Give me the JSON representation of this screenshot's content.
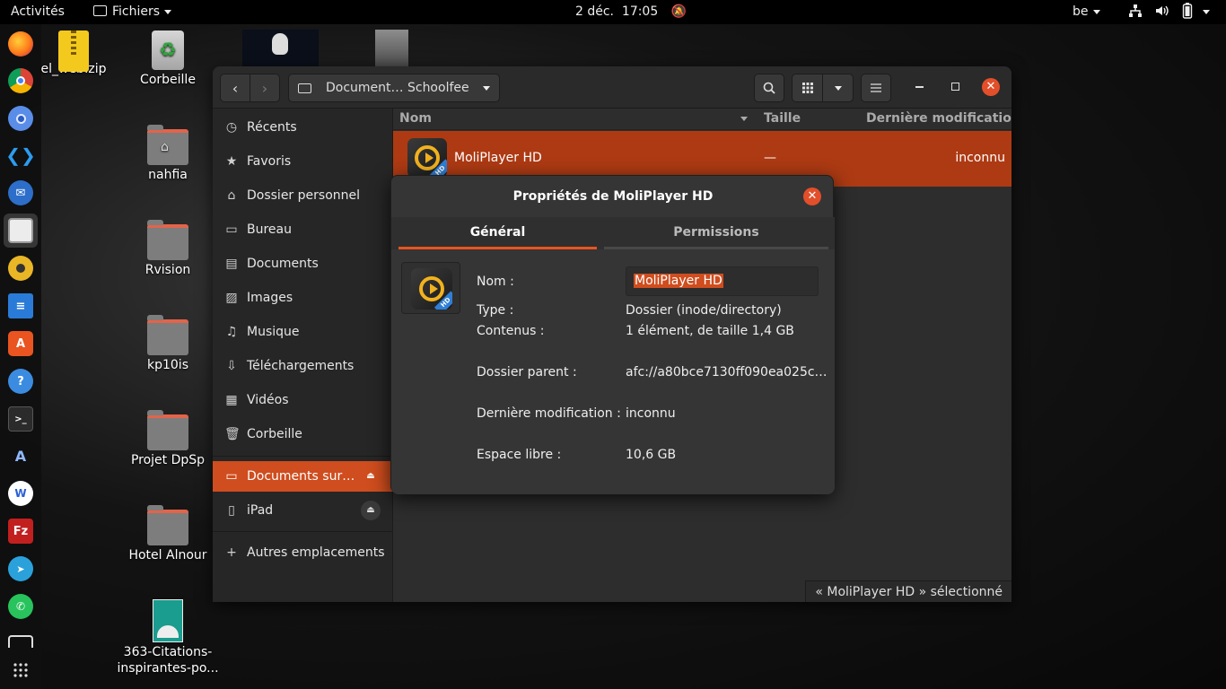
{
  "topbar": {
    "activities": "Activités",
    "app_menu": "Fichiers",
    "datetime": "2 déc.  17:05",
    "keyboard_layout": "be"
  },
  "dock": {
    "items": [
      "firefox",
      "chrome",
      "chromium",
      "vscode",
      "thunderbird",
      "files",
      "rhythmbox",
      "libreoffice-writer",
      "software-center",
      "help",
      "terminal",
      "dictionary",
      "wps",
      "filezilla",
      "telegram",
      "whatsapp",
      "trash",
      "show-apps"
    ]
  },
  "desktop": {
    "icons": [
      {
        "label": "el_web.zip"
      },
      {
        "label": "Corbeille"
      },
      {
        "label": "nahfia"
      },
      {
        "label": "Rvision"
      },
      {
        "label": "kp10is"
      },
      {
        "label": "Projet DpSp"
      },
      {
        "label": "Hotel Alnour"
      },
      {
        "label_line1": "363-Citations-",
        "label_line2": "inspirantes-po..."
      }
    ]
  },
  "fm": {
    "location": "Document… Schoolfee",
    "sidebar": [
      {
        "label": "Récents",
        "icon": "clock-icon"
      },
      {
        "label": "Favoris",
        "icon": "star-icon"
      },
      {
        "label": "Dossier personnel",
        "icon": "home-icon"
      },
      {
        "label": "Bureau",
        "icon": "desktop-icon"
      },
      {
        "label": "Documents",
        "icon": "document-icon"
      },
      {
        "label": "Images",
        "icon": "image-icon"
      },
      {
        "label": "Musique",
        "icon": "music-icon"
      },
      {
        "label": "Téléchargements",
        "icon": "download-icon"
      },
      {
        "label": "Vidéos",
        "icon": "video-icon"
      },
      {
        "label": "Corbeille",
        "icon": "trash-icon"
      },
      {
        "label": "Documents sur…",
        "icon": "drive-icon"
      },
      {
        "label": "iPad",
        "icon": "tablet-icon"
      },
      {
        "label": "Autres emplacements",
        "icon": "plus-icon"
      }
    ],
    "columns": {
      "name": "Nom",
      "size": "Taille",
      "modified": "Dernière modification"
    },
    "rows": [
      {
        "name": "MoliPlayer HD",
        "size": "—",
        "modified": "inconnu"
      }
    ],
    "status": "« MoliPlayer HD » sélectionné"
  },
  "dialog": {
    "title": "Propriétés de MoliPlayer HD",
    "tabs": {
      "general": "Général",
      "permissions": "Permissions"
    },
    "name_label": "Nom :",
    "name_value": "MoliPlayer HD",
    "type_label": "Type :",
    "type_value": "Dossier (inode/directory)",
    "contents_label": "Contenus :",
    "contents_value": "1 élément, de taille 1,4 GB",
    "parent_label": "Dossier parent :",
    "parent_value": "afc://a80bce7130ff090ea025c…",
    "modified_label": "Dernière modification :",
    "modified_value": "inconnu",
    "free_label": "Espace libre :",
    "free_value": "10,6 GB"
  },
  "colors": {
    "accent": "#cf4d1e",
    "selection": "#ad3a13",
    "close": "#e24f2a"
  }
}
